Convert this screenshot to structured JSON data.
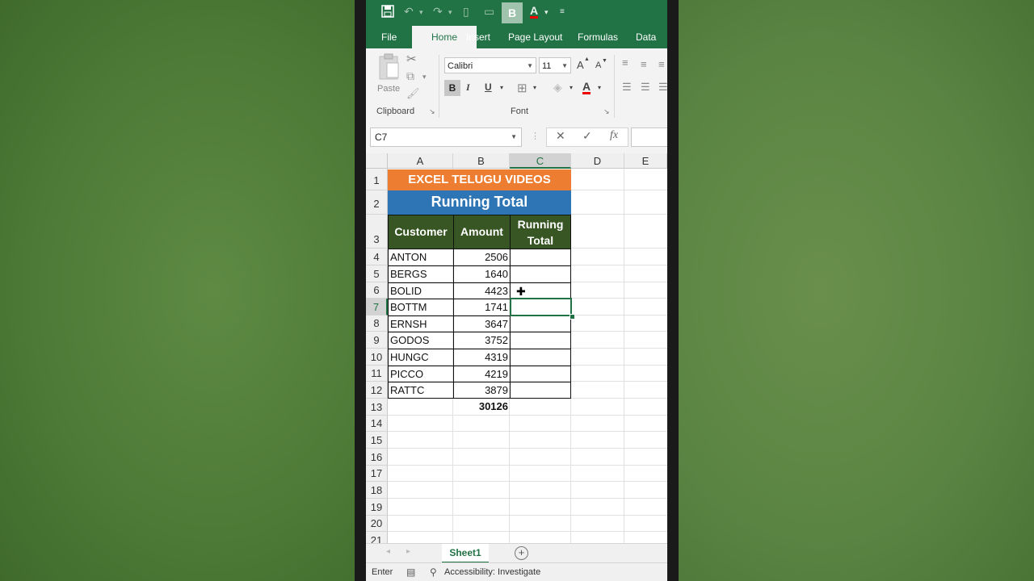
{
  "qat": {
    "bold_chip": "B",
    "font_color_letter": "A"
  },
  "tabs": [
    {
      "label": "File"
    },
    {
      "label": "Home"
    },
    {
      "label": "Insert"
    },
    {
      "label": "Page Layout"
    },
    {
      "label": "Formulas"
    },
    {
      "label": "Data"
    }
  ],
  "ribbon": {
    "paste_label": "Paste",
    "clipboard_group": "Clipboard",
    "font_group": "Font",
    "font_name": "Calibri",
    "font_size": "11",
    "bold": "B",
    "italic": "I",
    "underline": "U",
    "grow_font": "A",
    "shrink_font": "A",
    "font_color": "A"
  },
  "formula_bar": {
    "name_box": "C7",
    "cancel": "✕",
    "enter": "✓",
    "fx": "fx"
  },
  "columns": [
    "A",
    "B",
    "C",
    "D",
    "E"
  ],
  "rows": [
    "1",
    "2",
    "3",
    "4",
    "5",
    "6",
    "7",
    "8",
    "9",
    "10",
    "11",
    "12",
    "13",
    "14",
    "15",
    "16",
    "17",
    "18",
    "19",
    "20",
    "21"
  ],
  "sheet": {
    "title": "EXCEL TELUGU VIDEOS",
    "subtitle": "Running Total",
    "headers": {
      "customer": "Customer",
      "amount": "Amount",
      "running_line1": "Running",
      "running_line2": "Total"
    },
    "data": [
      {
        "customer": "ANTON",
        "amount": "2506"
      },
      {
        "customer": "BERGS",
        "amount": "1640"
      },
      {
        "customer": "BOLID",
        "amount": "4423"
      },
      {
        "customer": "BOTTM",
        "amount": "1741"
      },
      {
        "customer": "ERNSH",
        "amount": "3647"
      },
      {
        "customer": "GODOS",
        "amount": "3752"
      },
      {
        "customer": "HUNGC",
        "amount": "4319"
      },
      {
        "customer": "PICCO",
        "amount": "4219"
      },
      {
        "customer": "RATTC",
        "amount": "3879"
      }
    ],
    "total": "30126"
  },
  "sheet_tabs": {
    "active": "Sheet1",
    "add": "+"
  },
  "status": {
    "mode": "Enter",
    "accessibility": "Accessibility: Investigate"
  }
}
